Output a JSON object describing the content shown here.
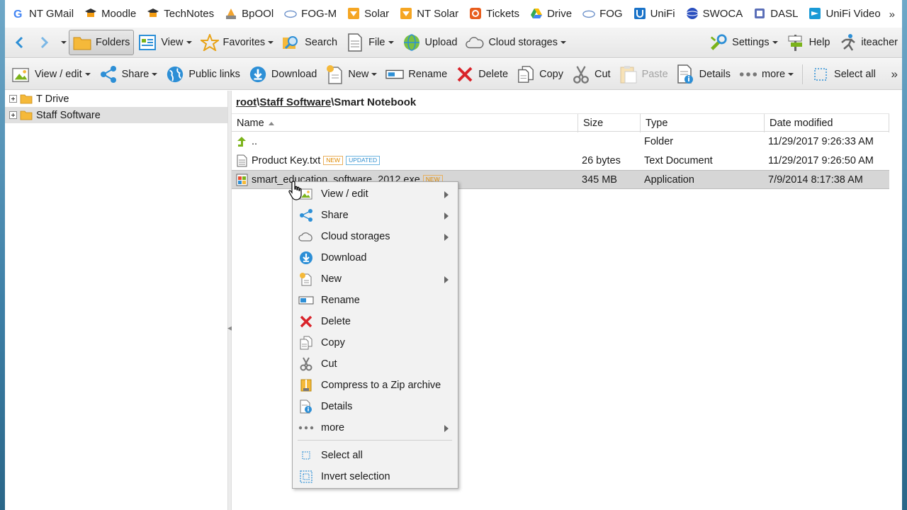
{
  "bookmarks": [
    {
      "label": "NT GMail",
      "icon": "google-icon"
    },
    {
      "label": "Moodle",
      "icon": "mortarboard-icon"
    },
    {
      "label": "TechNotes",
      "icon": "mortarboard-icon"
    },
    {
      "label": "BpOOl",
      "icon": "pma-icon"
    },
    {
      "label": "FOG-M",
      "icon": "cloud-icon"
    },
    {
      "label": "Solar",
      "icon": "solar-icon"
    },
    {
      "label": "NT Solar",
      "icon": "solar-icon"
    },
    {
      "label": "Tickets",
      "icon": "tickets-icon"
    },
    {
      "label": "Drive",
      "icon": "drive-icon"
    },
    {
      "label": "FOG",
      "icon": "cloud-icon"
    },
    {
      "label": "UniFi",
      "icon": "unifi-icon"
    },
    {
      "label": "SWOCA",
      "icon": "globe-icon"
    },
    {
      "label": "DASL",
      "icon": "dasl-icon"
    },
    {
      "label": "UniFi Video",
      "icon": "unifi-video-icon"
    }
  ],
  "bookmarks_more": "»",
  "toolbar1": {
    "folders": "Folders",
    "view": "View",
    "favorites": "Favorites",
    "search": "Search",
    "file": "File",
    "upload": "Upload",
    "cloud_storages": "Cloud storages",
    "settings": "Settings",
    "help": "Help",
    "user": "iteacher"
  },
  "toolbar2": {
    "view_edit": "View / edit",
    "share": "Share",
    "public_links": "Public links",
    "download": "Download",
    "new": "New",
    "rename": "Rename",
    "delete": "Delete",
    "copy": "Copy",
    "cut": "Cut",
    "paste": "Paste",
    "details": "Details",
    "more": "more",
    "select_all": "Select all",
    "overflow": "»"
  },
  "tree": [
    {
      "label": "T Drive",
      "selected": false
    },
    {
      "label": "Staff Software",
      "selected": true
    }
  ],
  "breadcrumb": {
    "root": "root",
    "sep1": "\\",
    "staff": "Staff Software",
    "sep2": "\\",
    "current": "Smart Notebook"
  },
  "grid": {
    "headers": {
      "name": "Name",
      "size": "Size",
      "type": "Type",
      "date": "Date modified"
    },
    "rows": [
      {
        "name": "..",
        "size": "",
        "type": "Folder",
        "date": "11/29/2017 9:26:33 AM",
        "icon": "up-arrow-icon"
      },
      {
        "name": "Product Key.txt",
        "size": "26 bytes",
        "type": "Text Document",
        "date": "11/29/2017 9:26:50 AM",
        "icon": "text-file-icon",
        "badge_new": "NEW",
        "badge_updated": "UPDATED"
      },
      {
        "name": "smart_education_software_2012.exe",
        "size": "345 MB",
        "type": "Application",
        "date": "7/9/2014 8:17:38 AM",
        "icon": "exe-file-icon",
        "badge_new": "NEW"
      }
    ]
  },
  "context_menu": {
    "items": [
      {
        "label": "View / edit",
        "icon": "image-icon",
        "submenu": true
      },
      {
        "label": "Share",
        "icon": "share-icon",
        "submenu": true
      },
      {
        "label": "Cloud storages",
        "icon": "cloud-icon",
        "submenu": true
      },
      {
        "label": "Download",
        "icon": "download-icon",
        "submenu": false
      },
      {
        "label": "New",
        "icon": "new-file-icon",
        "submenu": true
      },
      {
        "label": "Rename",
        "icon": "rename-icon",
        "submenu": false
      },
      {
        "label": "Delete",
        "icon": "delete-icon",
        "submenu": false
      },
      {
        "label": "Copy",
        "icon": "copy-icon",
        "submenu": false
      },
      {
        "label": "Cut",
        "icon": "scissors-icon",
        "submenu": false
      },
      {
        "label": "Compress to a Zip archive",
        "icon": "zip-icon",
        "submenu": false
      },
      {
        "label": "Details",
        "icon": "details-icon",
        "submenu": false
      },
      {
        "label": "more",
        "icon": "more-icon",
        "submenu": true
      },
      {
        "label": "Select all",
        "icon": "select-all-icon",
        "submenu": false
      },
      {
        "label": "Invert selection",
        "icon": "invert-selection-icon",
        "submenu": false
      }
    ]
  },
  "colors": {
    "accent_blue": "#2d8fd6",
    "delete_red": "#d9232a",
    "folder_yellow": "#f5b93a",
    "green": "#7bb31a"
  }
}
